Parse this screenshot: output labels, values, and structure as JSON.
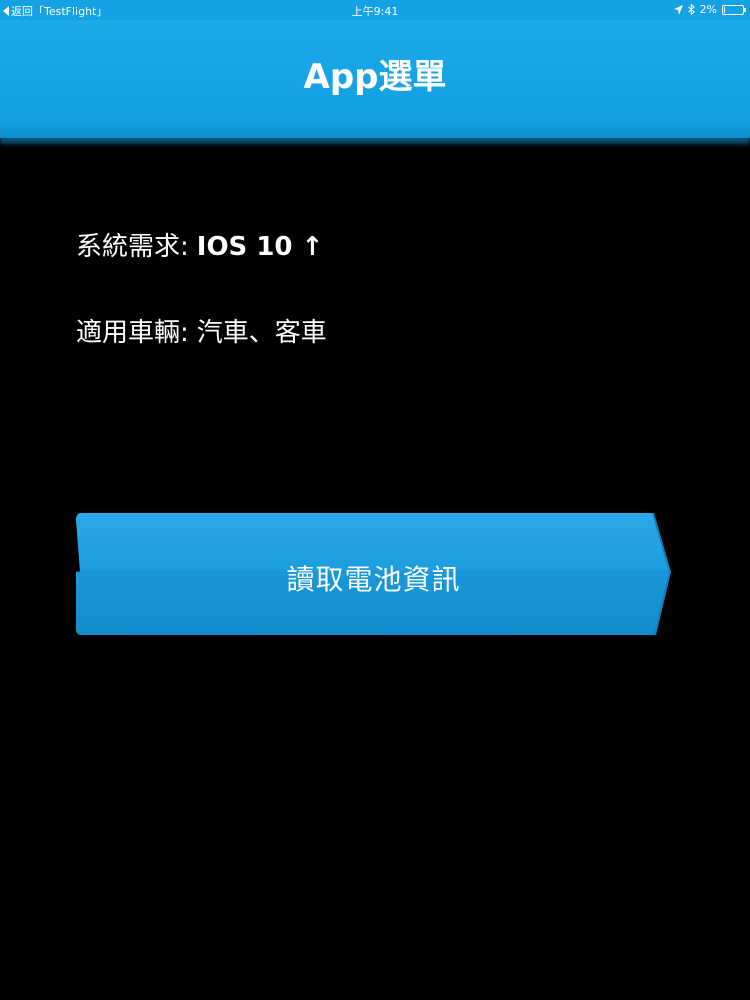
{
  "status_bar": {
    "back_label": "返回「TestFlight」",
    "time": "上午9:41",
    "battery_text": "2%",
    "battery_level": 0.02,
    "icons": [
      "back-arrow-icon",
      "location-arrow-icon",
      "bluetooth-icon",
      "battery-icon"
    ]
  },
  "nav": {
    "title": "App選單"
  },
  "info": {
    "requirement_label": "系統需求:",
    "requirement_value": "IOS 10 ↑",
    "vehicle_label": "適用車輛:",
    "vehicle_value": "汽車、客車"
  },
  "actions": {
    "read_battery_label": "讀取電池資訊"
  },
  "colors": {
    "accent": "#14A2E5",
    "background": "#000000",
    "text": "#FFFFFF",
    "button": "#1A9CDF"
  }
}
